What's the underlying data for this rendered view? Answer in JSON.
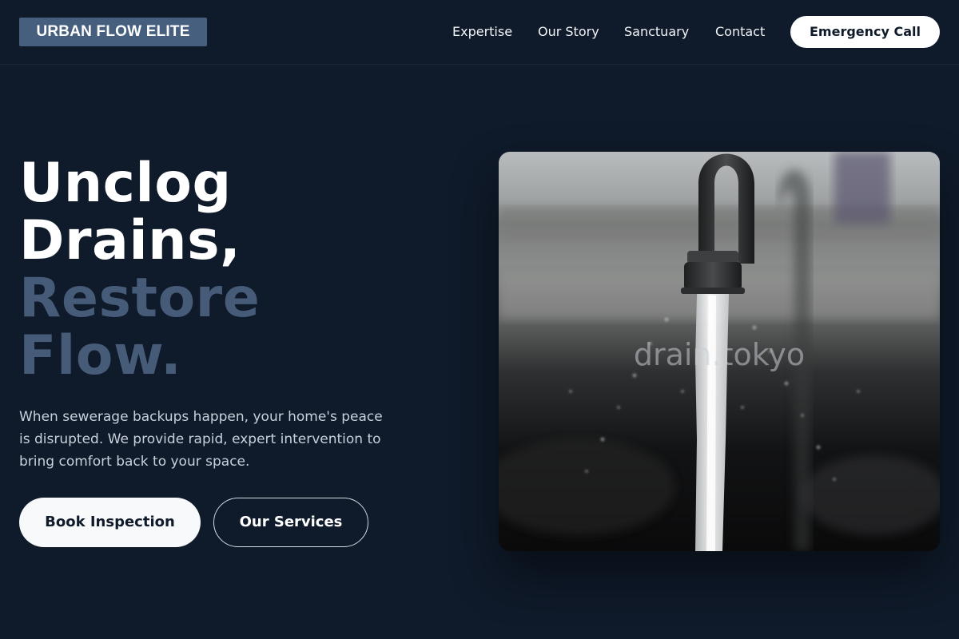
{
  "brand": {
    "logo_text": "URBAN FLOW ELITE"
  },
  "nav": {
    "items": [
      {
        "label": "Expertise"
      },
      {
        "label": "Our Story"
      },
      {
        "label": "Sanctuary"
      },
      {
        "label": "Contact"
      }
    ],
    "cta_label": "Emergency Call"
  },
  "hero": {
    "headline_lines": [
      "Unclog",
      "Drains,",
      "Restore",
      "Flow."
    ],
    "description": "When sewerage backups happen, your home's peace is disrupted. We provide rapid, expert intervention to bring comfort back to your space.",
    "primary_button": "Book Inspection",
    "secondary_button": "Our Services",
    "image_watermark": "drain.tokyo",
    "image_subject": "faucet-running-water"
  },
  "colors": {
    "background": "#0f1a2a",
    "accent": "#455b78",
    "logo_bg": "#475f7e",
    "text_primary": "#ffffff",
    "text_muted": "#c8d0db"
  }
}
